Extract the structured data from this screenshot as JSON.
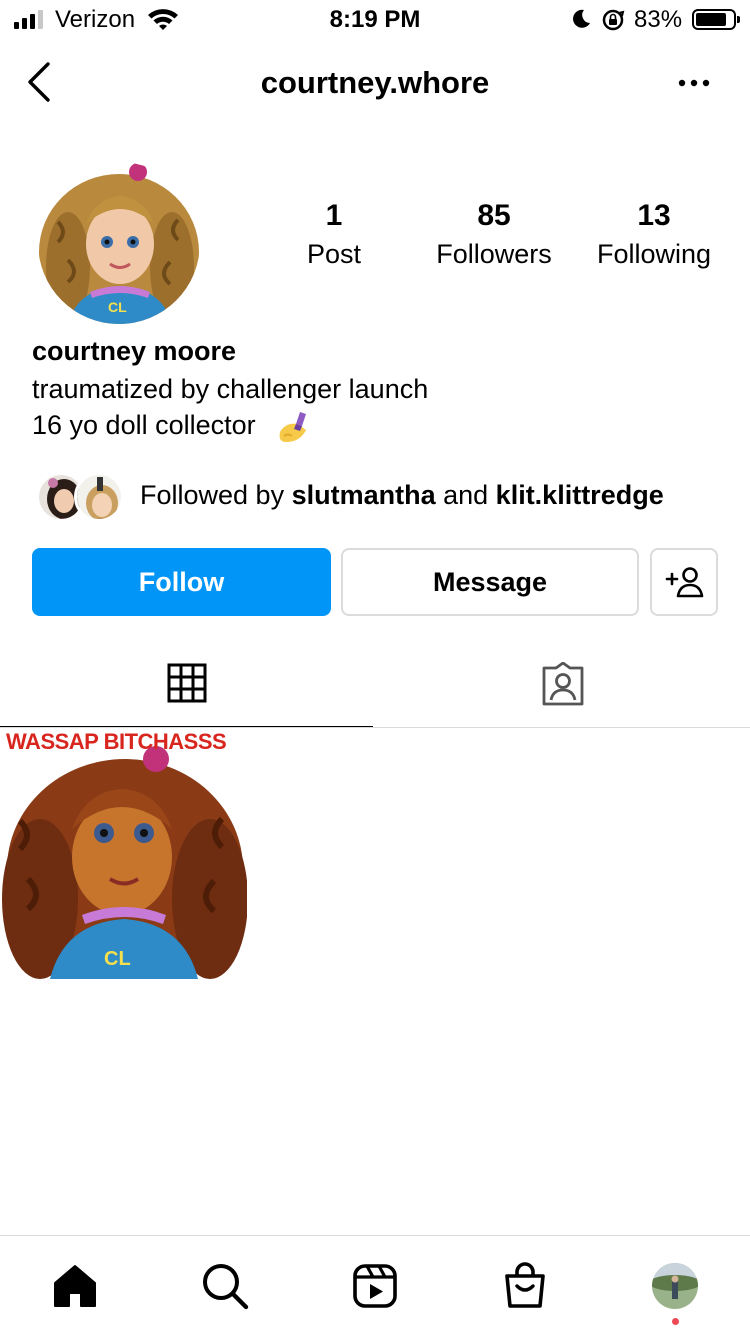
{
  "status_bar": {
    "carrier": "Verizon",
    "time": "8:19 PM",
    "battery_percent": "83%",
    "battery_level": 0.83,
    "signal_bars": 3
  },
  "header": {
    "username": "courtney.whore",
    "back_icon": "chevron-left-icon",
    "more_icon": "more-horizontal-icon"
  },
  "stats": {
    "posts": {
      "value": "1",
      "label": "Post"
    },
    "followers": {
      "value": "85",
      "label": "Followers"
    },
    "following": {
      "value": "13",
      "label": "Following"
    }
  },
  "bio": {
    "name": "courtney moore",
    "line1": "traumatized by challenger launch",
    "line2": "16 yo doll collector",
    "emoji": "nail-polish-emoji"
  },
  "followed_by": {
    "prefix": "Followed by ",
    "user1": "slutmantha",
    "conjunction": " and ",
    "user2": "klit.klittredge"
  },
  "buttons": {
    "follow": "Follow",
    "message": "Message",
    "add_user_icon": "add-person-icon"
  },
  "tabs": {
    "grid_icon": "grid-icon",
    "tagged_icon": "tagged-user-icon",
    "active": "grid"
  },
  "posts": [
    {
      "caption": "WASSAP BITCHASSS"
    }
  ],
  "nav": {
    "items": [
      "home-icon",
      "search-icon",
      "reels-icon",
      "shop-icon",
      "profile-avatar"
    ],
    "notification_dot": true
  },
  "colors": {
    "primary_blue": "#0095f6",
    "border_gray": "#dbdbdb",
    "caption_red": "#d8261f",
    "notification_red": "#ed4956"
  }
}
